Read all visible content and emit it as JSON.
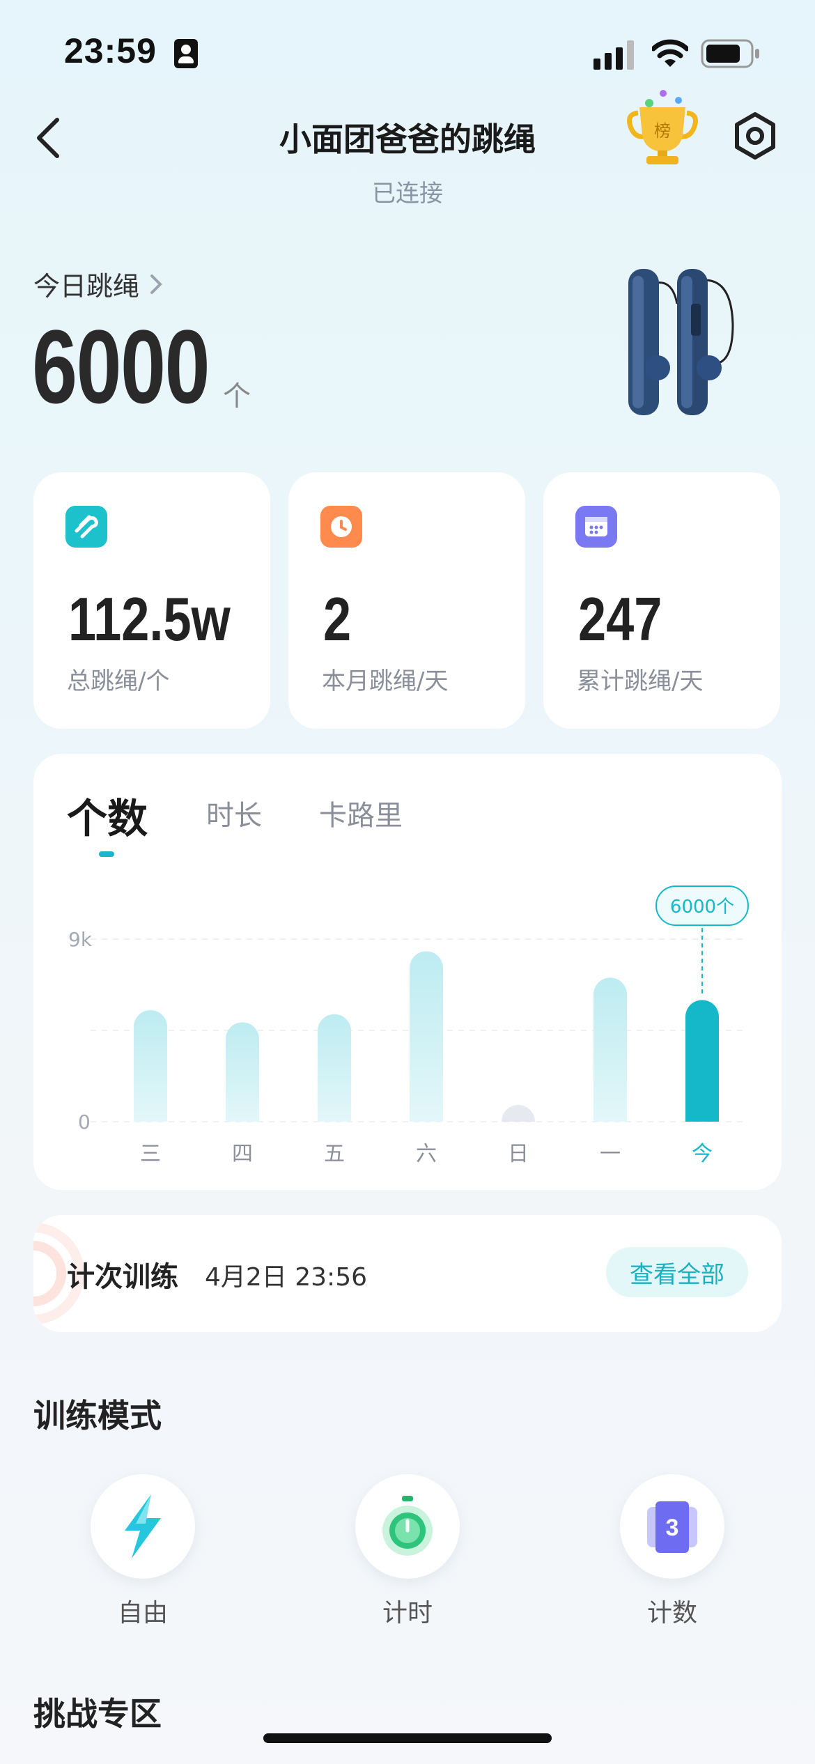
{
  "status_bar": {
    "time": "23:59"
  },
  "header": {
    "title": "小面团爸爸的跳绳",
    "subtitle": "已连接",
    "trophy_text": "榜"
  },
  "today": {
    "label": "今日跳绳",
    "value": "6000",
    "unit": "个"
  },
  "stats": [
    {
      "value": "112.5w",
      "label": "总跳绳/个",
      "icon": "rope-icon",
      "color": "#1cc1cc"
    },
    {
      "value": "2",
      "label": "本月跳绳/天",
      "icon": "clock-icon",
      "color": "#ff8a4d"
    },
    {
      "value": "247",
      "label": "累计跳绳/天",
      "icon": "calendar-icon",
      "color": "#7b79f2"
    }
  ],
  "chart": {
    "tabs": [
      "个数",
      "时长",
      "卡路里"
    ],
    "active_tab": 0,
    "tooltip": "6000个"
  },
  "chart_data": {
    "type": "bar",
    "categories": [
      "三",
      "四",
      "五",
      "六",
      "日",
      "一",
      "今"
    ],
    "values": [
      5500,
      4900,
      5300,
      8400,
      0,
      7100,
      6000
    ],
    "ylim": [
      0,
      9000
    ],
    "yticks": [
      "0",
      "9k"
    ],
    "highlight_index": 6,
    "colors": {
      "bar": "#c4eef2",
      "highlight": "#14b8c8",
      "empty": "#e6eaf0"
    }
  },
  "record": {
    "title": "计次训练",
    "time": "4月2日 23:56",
    "button": "查看全部"
  },
  "training_modes": {
    "title": "训练模式",
    "items": [
      {
        "label": "自由",
        "icon": "lightning-icon"
      },
      {
        "label": "计时",
        "icon": "stopwatch-icon"
      },
      {
        "label": "计数",
        "icon": "counter-icon",
        "digit": "3"
      }
    ]
  },
  "challenge": {
    "title": "挑战专区"
  }
}
